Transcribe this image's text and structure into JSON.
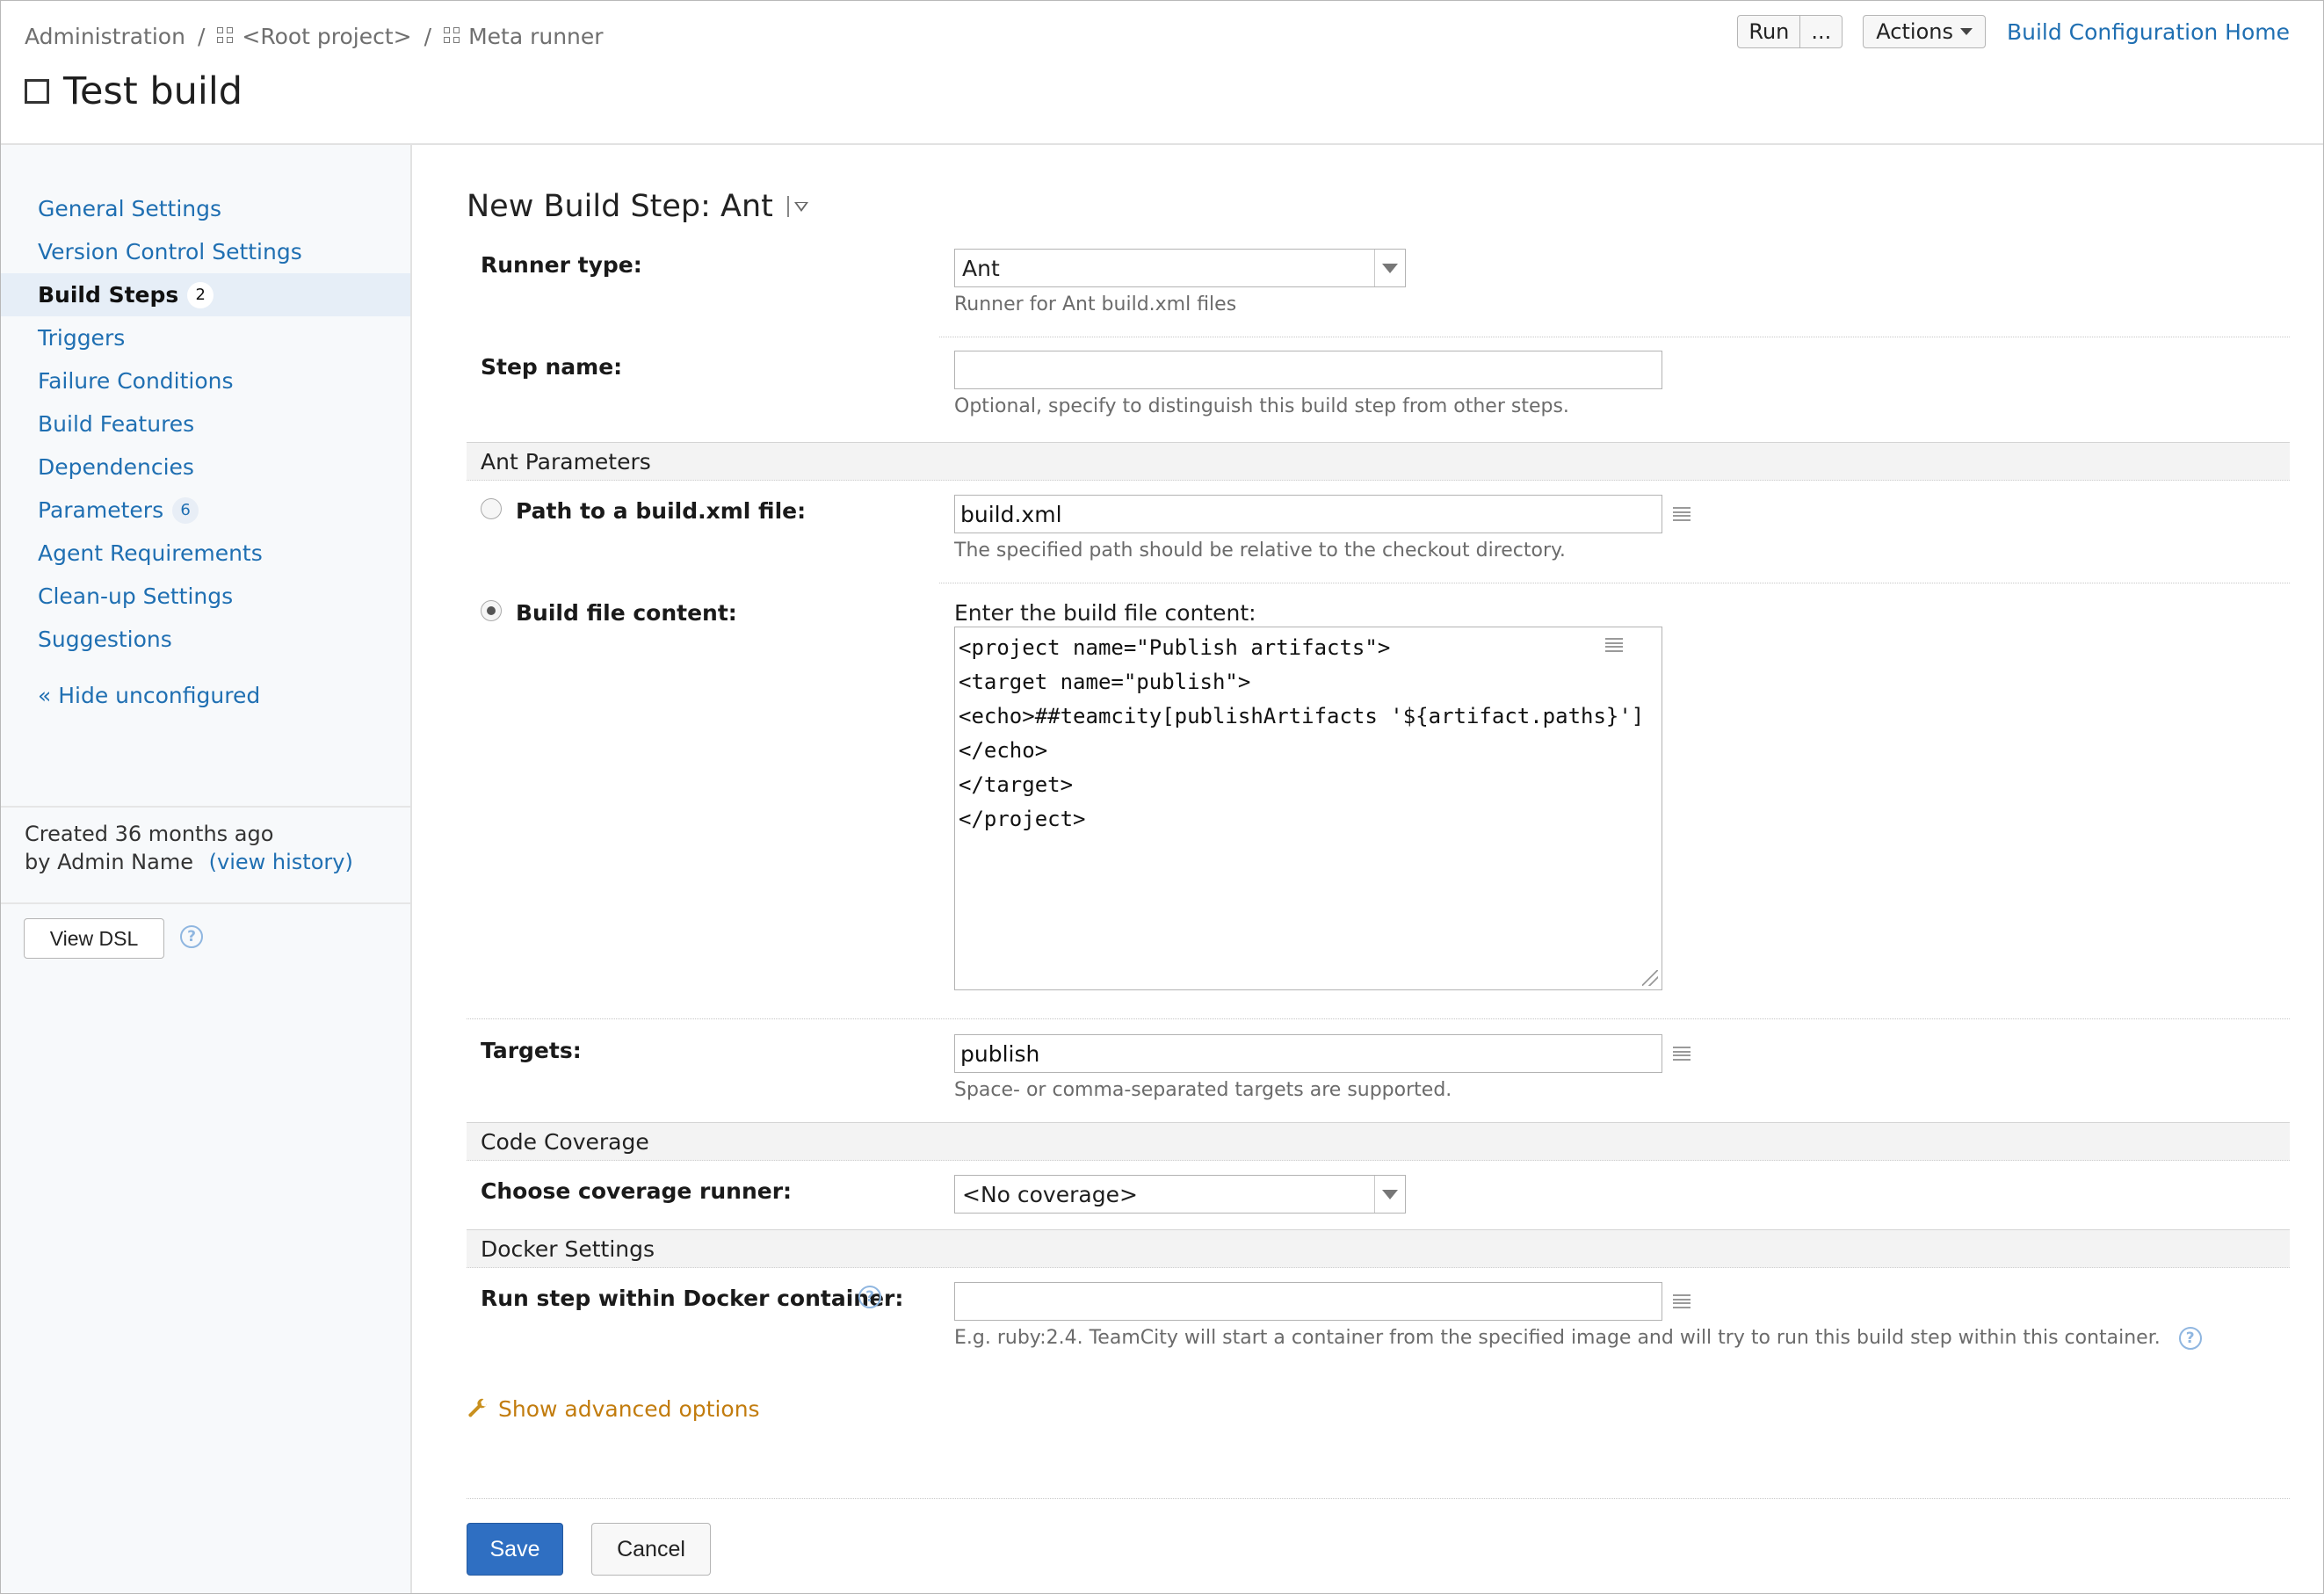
{
  "breadcrumb": {
    "items": [
      "Administration",
      "<Root project>",
      "Meta runner"
    ],
    "separator": "/"
  },
  "page_title": "Test build",
  "header_actions": {
    "run_label": "Run",
    "run_more_label": "...",
    "actions_label": "Actions",
    "home_link": "Build Configuration Home"
  },
  "sidebar": {
    "items": [
      {
        "label": "General Settings"
      },
      {
        "label": "Version Control Settings"
      },
      {
        "label": "Build Steps",
        "badge": "2",
        "active": true
      },
      {
        "label": "Triggers"
      },
      {
        "label": "Failure Conditions"
      },
      {
        "label": "Build Features"
      },
      {
        "label": "Dependencies"
      },
      {
        "label": "Parameters",
        "badge": "6"
      },
      {
        "label": "Agent Requirements"
      },
      {
        "label": "Clean-up Settings"
      },
      {
        "label": "Suggestions"
      }
    ],
    "hide_unconfigured": "« Hide unconfigured",
    "created_line": "Created 36 months ago",
    "by_line": "by Admin Name",
    "view_history_open": "(",
    "view_history": "view history",
    "view_history_close": ")",
    "view_dsl": "View DSL",
    "help_glyph": "?"
  },
  "form": {
    "heading": "New Build Step: Ant",
    "runner_type": {
      "label": "Runner type:",
      "value": "Ant",
      "note": "Runner for Ant build.xml files"
    },
    "step_name": {
      "label": "Step name:",
      "value": "",
      "note": "Optional, specify to distinguish this build step from other steps."
    },
    "ant_section": "Ant Parameters",
    "path_option": {
      "label": "Path to a build.xml file:",
      "value": "build.xml",
      "note": "The specified path should be relative to the checkout directory.",
      "selected": false
    },
    "content_option": {
      "label": "Build file content:",
      "caption": "Enter the build file content:",
      "selected": true,
      "lines": [
        "<project name=\"Publish artifacts\">",
        "<target name=\"publish\">",
        "<echo>##teamcity[publishArtifacts '${artifact.paths}']",
        "</echo>",
        "</target>",
        "</project>"
      ]
    },
    "targets": {
      "label": "Targets:",
      "value": "publish",
      "note": "Space- or comma-separated targets are supported."
    },
    "coverage_section": "Code Coverage",
    "coverage": {
      "label": "Choose coverage runner:",
      "value": "<No coverage>"
    },
    "docker_section": "Docker Settings",
    "docker": {
      "label": "Run step within Docker container:",
      "value": "",
      "note": "E.g. ruby:2.4. TeamCity will start a container from the specified image and will try to run this build step within this container."
    },
    "show_advanced": "Show advanced options",
    "save": "Save",
    "cancel": "Cancel"
  },
  "colors": {
    "link": "#1f6fb2",
    "primary_button": "#2f6fc2",
    "advanced_link": "#c27c0e",
    "active_nav_bg": "#e6eef7"
  },
  "icons": [
    "grid-icon",
    "checkbox-icon",
    "chevron-down-icon",
    "help-icon",
    "field-menu-icon",
    "wrench-icon",
    "resize-grip-icon"
  ]
}
